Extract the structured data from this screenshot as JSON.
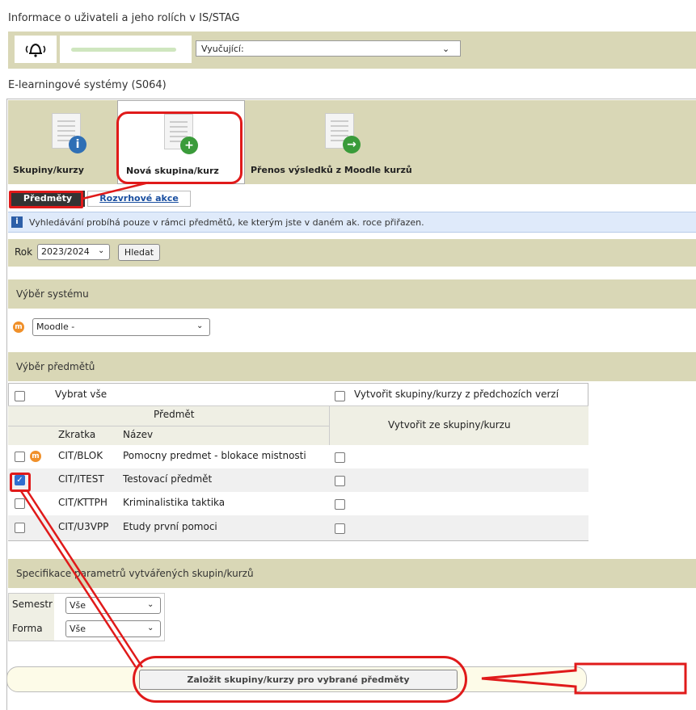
{
  "header": {
    "title": "Informace o uživateli a jeho rolích v IS/STAG",
    "role_label": "Vyučující:"
  },
  "section_title": "E-learningové systémy (S064)",
  "toolbar": {
    "items": [
      {
        "label": "Skupiny/kurzy",
        "icon": "info-icon"
      },
      {
        "label": "Nová skupina/kurz",
        "icon": "plus-icon"
      },
      {
        "label": "Přenos výsledků z Moodle kurzů",
        "icon": "arrow-right-icon"
      }
    ]
  },
  "tabs": {
    "active": "Předměty",
    "other": "Rozvrhové akce"
  },
  "info_text": "Vyhledávání probíhá pouze v rámci předmětů, ke kterým jste v daném ak. roce přiřazen.",
  "year": {
    "label": "Rok",
    "value": "2023/2024",
    "search": "Hledat"
  },
  "system": {
    "heading": "Výběr systému",
    "value": "Moodle -"
  },
  "subjects": {
    "heading": "Výběr předmětů",
    "select_all": "Vybrat vše",
    "create_prev": "Vytvořit skupiny/kurzy z předchozích verzí",
    "col_subject": "Předmět",
    "col_abbr": "Zkratka",
    "col_name": "Název",
    "col_create_from": "Vytvořit ze skupiny/kurzu",
    "rows": [
      {
        "abbr": "CIT/BLOK",
        "name": "Pomocny predmet - blokace mistnosti",
        "checked": false,
        "moodle": true
      },
      {
        "abbr": "CIT/ITEST",
        "name": "Testovací předmět",
        "checked": true,
        "moodle": false
      },
      {
        "abbr": "CIT/KTTPH",
        "name": "Kriminalistika taktika",
        "checked": false,
        "moodle": false
      },
      {
        "abbr": "CIT/U3VPP",
        "name": "Etudy první pomoci",
        "checked": false,
        "moodle": false
      }
    ]
  },
  "params": {
    "heading": "Specifikace parametrů vytvářených skupin/kurzů",
    "semester_label": "Semestr",
    "semester_value": "Vše",
    "form_label": "Forma",
    "form_value": "Vše"
  },
  "submit_label": "Založit skupiny/kurzy pro vybrané předměty",
  "colors": {
    "accent": "#d9d7b6",
    "highlight": "#e01a1a",
    "checkbox": "#2f6fd0"
  }
}
